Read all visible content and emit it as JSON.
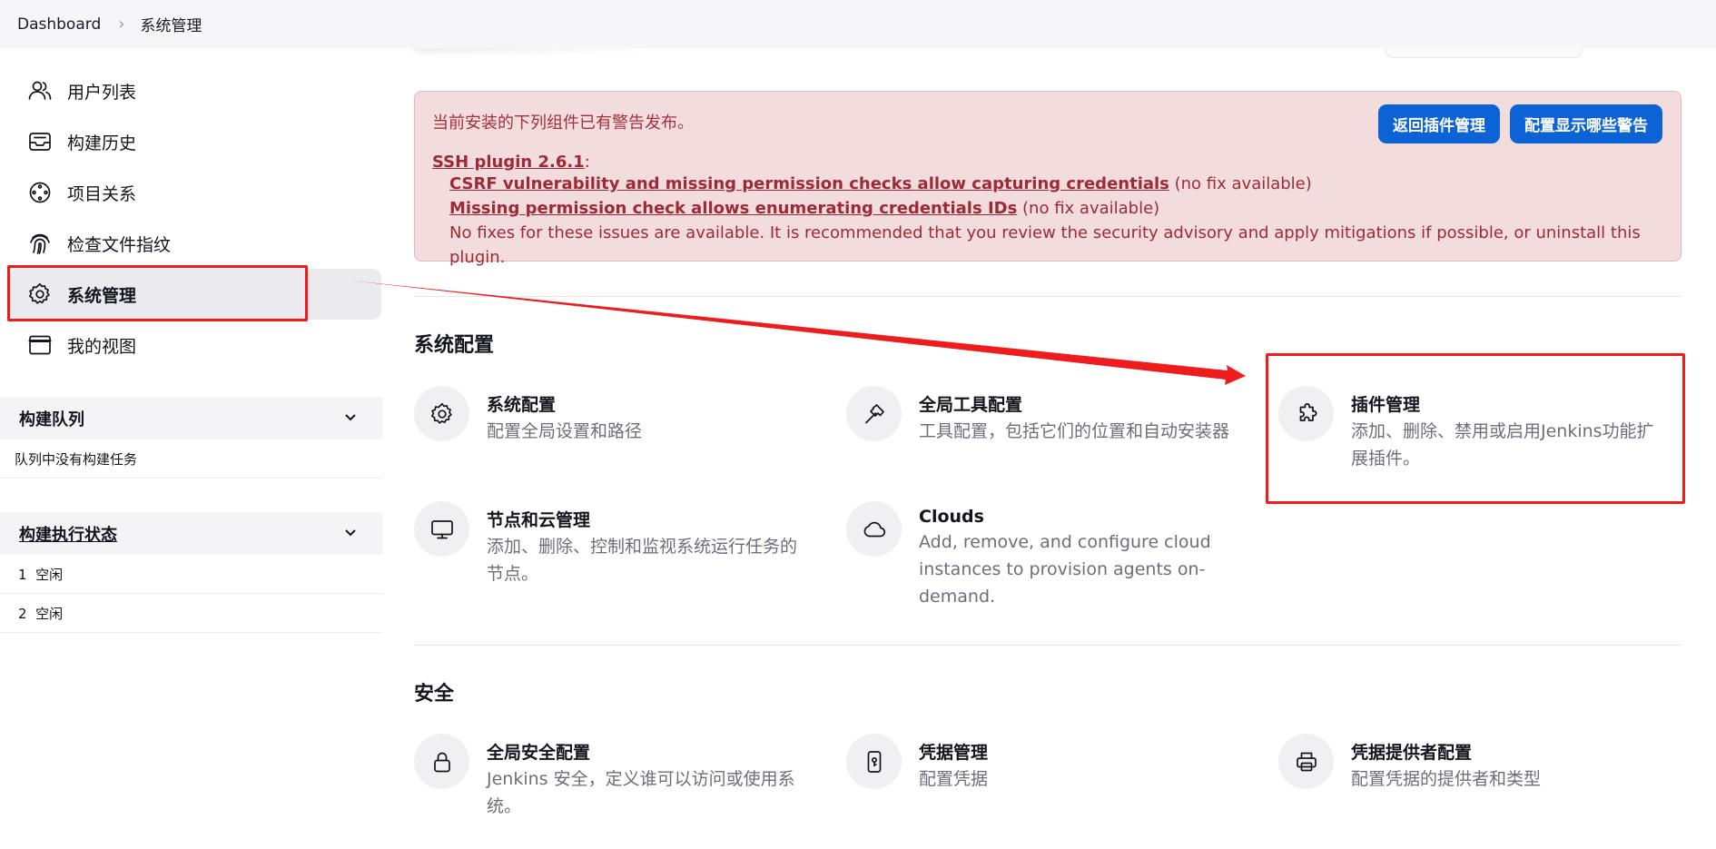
{
  "breadcrumb": {
    "home": "Dashboard",
    "current": "系统管理"
  },
  "sidebar": {
    "items": [
      {
        "label": "用户列表",
        "icon": "users-icon"
      },
      {
        "label": "构建历史",
        "icon": "inbox-icon"
      },
      {
        "label": "项目关系",
        "icon": "relationship-icon"
      },
      {
        "label": "检查文件指纹",
        "icon": "fingerprint-icon"
      },
      {
        "label": "系统管理",
        "icon": "gear-icon",
        "active": true
      },
      {
        "label": "我的视图",
        "icon": "window-icon"
      }
    ],
    "queue": {
      "title": "构建队列",
      "empty": "队列中没有构建任务"
    },
    "executors": {
      "title": "构建执行状态",
      "rows": [
        "1  空闲",
        "2  空闲"
      ]
    }
  },
  "alert": {
    "intro": "当前安装的下列组件已有警告发布。",
    "plugin": "SSH plugin 2.6.1",
    "plugin_suffix": ":",
    "issues": [
      {
        "link": "CSRF vulnerability and missing permission checks allow capturing credentials",
        "note": " (no fix available)"
      },
      {
        "link": "Missing permission check allows enumerating credentials IDs",
        "note": " (no fix available)"
      }
    ],
    "footer": "No fixes for these issues are available. It is recommended that you review the security advisory and apply mitigations if possible, or uninstall this plugin.",
    "buttons": {
      "back": "返回插件管理",
      "configure": "配置显示哪些警告"
    },
    "colors": {
      "background": "#f3dcde",
      "text": "#9c2b36",
      "button": "#0b63d6"
    }
  },
  "sections": {
    "system_config": {
      "title": "系统配置",
      "cards": [
        {
          "title": "系统配置",
          "desc": "配置全局设置和路径",
          "icon": "gear-icon"
        },
        {
          "title": "全局工具配置",
          "desc": "工具配置，包括它们的位置和自动安装器",
          "icon": "hammer-icon"
        },
        {
          "title": "插件管理",
          "desc": "添加、删除、禁用或启用Jenkins功能扩展插件。",
          "icon": "puzzle-icon"
        },
        {
          "title": "节点和云管理",
          "desc": "添加、删除、控制和监视系统运行任务的节点。",
          "icon": "monitor-icon"
        },
        {
          "title": "Clouds",
          "desc": "Add, remove, and configure cloud instances to provision agents on-demand.",
          "icon": "cloud-icon"
        }
      ]
    },
    "security": {
      "title": "安全",
      "cards": [
        {
          "title": "全局安全配置",
          "desc": "Jenkins 安全，定义谁可以访问或使用系统。",
          "icon": "lock-icon"
        },
        {
          "title": "凭据管理",
          "desc": "配置凭据",
          "icon": "phone-key-icon"
        },
        {
          "title": "凭据提供者配置",
          "desc": "配置凭据的提供者和类型",
          "icon": "printer-icon"
        }
      ]
    }
  },
  "annotation": {
    "color": "#ee1c1c"
  }
}
